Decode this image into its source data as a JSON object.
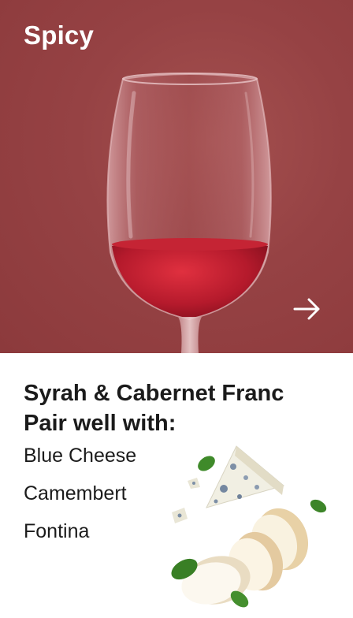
{
  "hero": {
    "title": "Spicy",
    "next_icon": "arrow-right-icon"
  },
  "pairing": {
    "title_line1": "Syrah & Cabernet Franc",
    "title_line2": "Pair well with:",
    "items": [
      {
        "label": "Blue Cheese"
      },
      {
        "label": "Camembert"
      },
      {
        "label": "Fontina"
      }
    ]
  },
  "colors": {
    "hero_background": "#964244",
    "wine": "#b51a2c",
    "text": "#1b1b1b"
  }
}
